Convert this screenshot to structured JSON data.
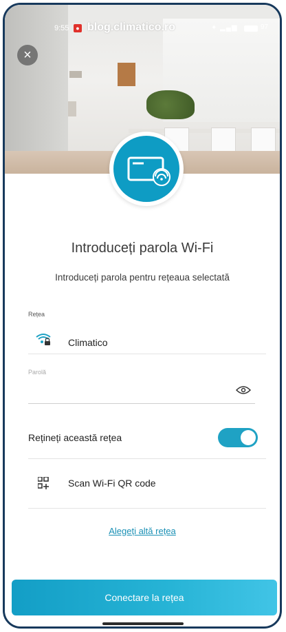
{
  "status_bar": {
    "time": "9:55",
    "record_badge": "●",
    "url": "blog.climatico.ro",
    "signal_icons": "✦ ▂▄▆",
    "battery_level": "97"
  },
  "header": {
    "close_icon": "close-icon",
    "device_icon": "air-conditioner-wifi-icon"
  },
  "main": {
    "title": "Introduceți parola Wi-Fi",
    "subtitle": "Introduceți parola pentru rețeaua selectată"
  },
  "network": {
    "label": "Rețea",
    "icon": "wifi-lock-icon",
    "name": "Climatico"
  },
  "password": {
    "label": "Parolă",
    "value": "",
    "placeholder": "",
    "toggle_icon": "eye-icon"
  },
  "remember": {
    "label": "Rețineți această rețea",
    "enabled": true
  },
  "qr": {
    "icon": "qr-code-icon",
    "label": "Scan Wi-Fi QR code"
  },
  "links": {
    "choose_other": "Alegeți altă rețea"
  },
  "footer": {
    "connect_label": "Conectare la rețea"
  },
  "colors": {
    "accent": "#1fa2c4",
    "link": "#1a90b5",
    "frame": "#17395c"
  }
}
